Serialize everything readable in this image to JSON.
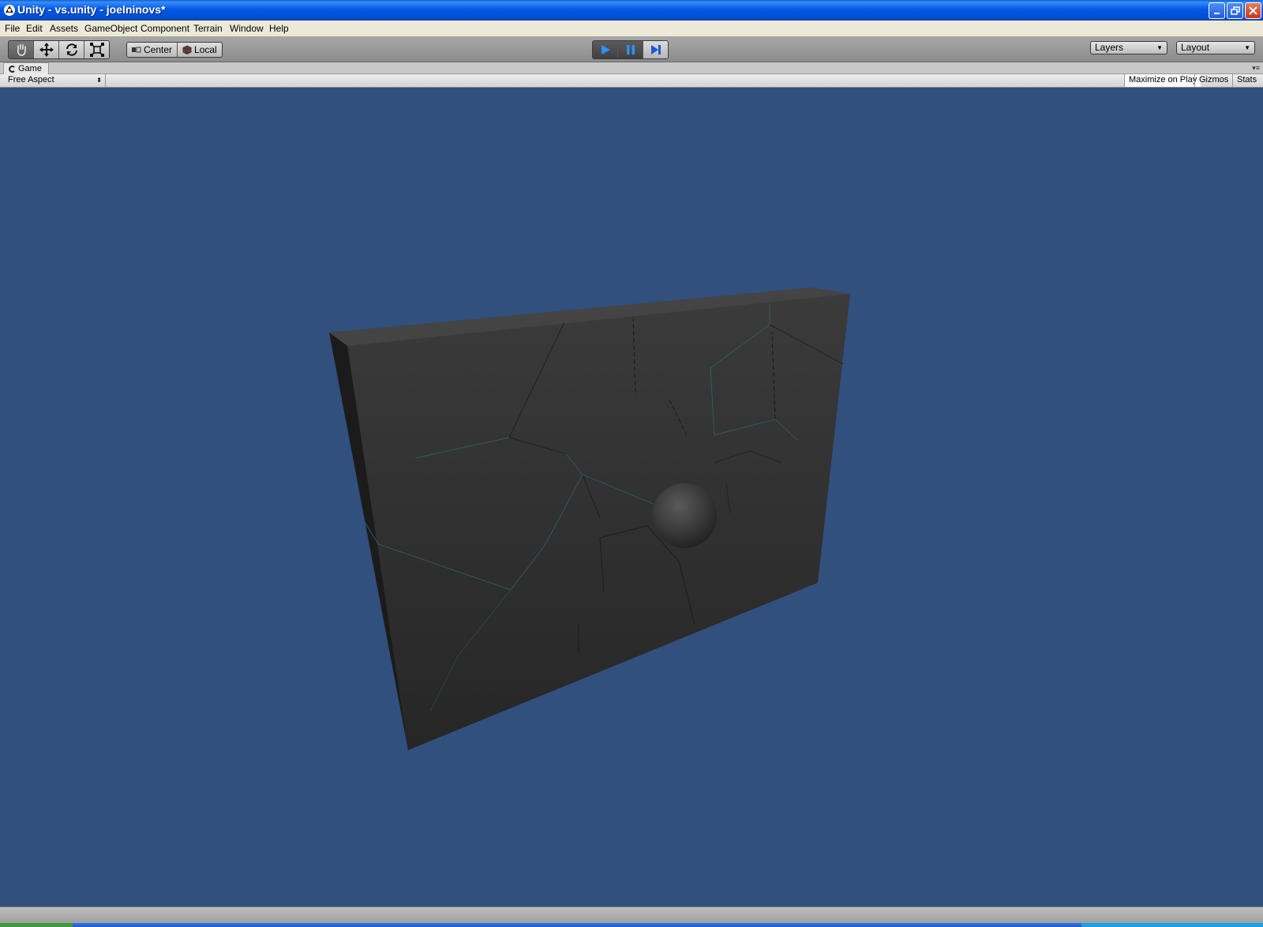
{
  "window": {
    "title": "Unity - vs.unity - joelninovs*",
    "icons": [
      "unity-logo-icon",
      "minimize-icon",
      "restore-icon",
      "close-icon"
    ]
  },
  "menu": [
    "File",
    "Edit",
    "Assets",
    "GameObject",
    "Component",
    "Terrain",
    "Window",
    "Help"
  ],
  "toolbar": {
    "transform_tools": [
      "hand-icon",
      "move-icon",
      "rotate-icon",
      "scale-icon"
    ],
    "pivot_mode": "Center",
    "pivot_rotation": "Local",
    "play_controls": [
      "play-icon",
      "pause-icon",
      "step-icon"
    ],
    "layers_label": "Layers",
    "layout_label": "Layout"
  },
  "game_view": {
    "tab_label": "Game",
    "aspect": "Free Aspect",
    "maximize_on_play": "Maximize on Play",
    "gizmos": "Gizmos",
    "stats": "Stats",
    "background_color": "#31507d"
  },
  "scene": {
    "objects": [
      "fractured-wall",
      "sphere"
    ]
  }
}
